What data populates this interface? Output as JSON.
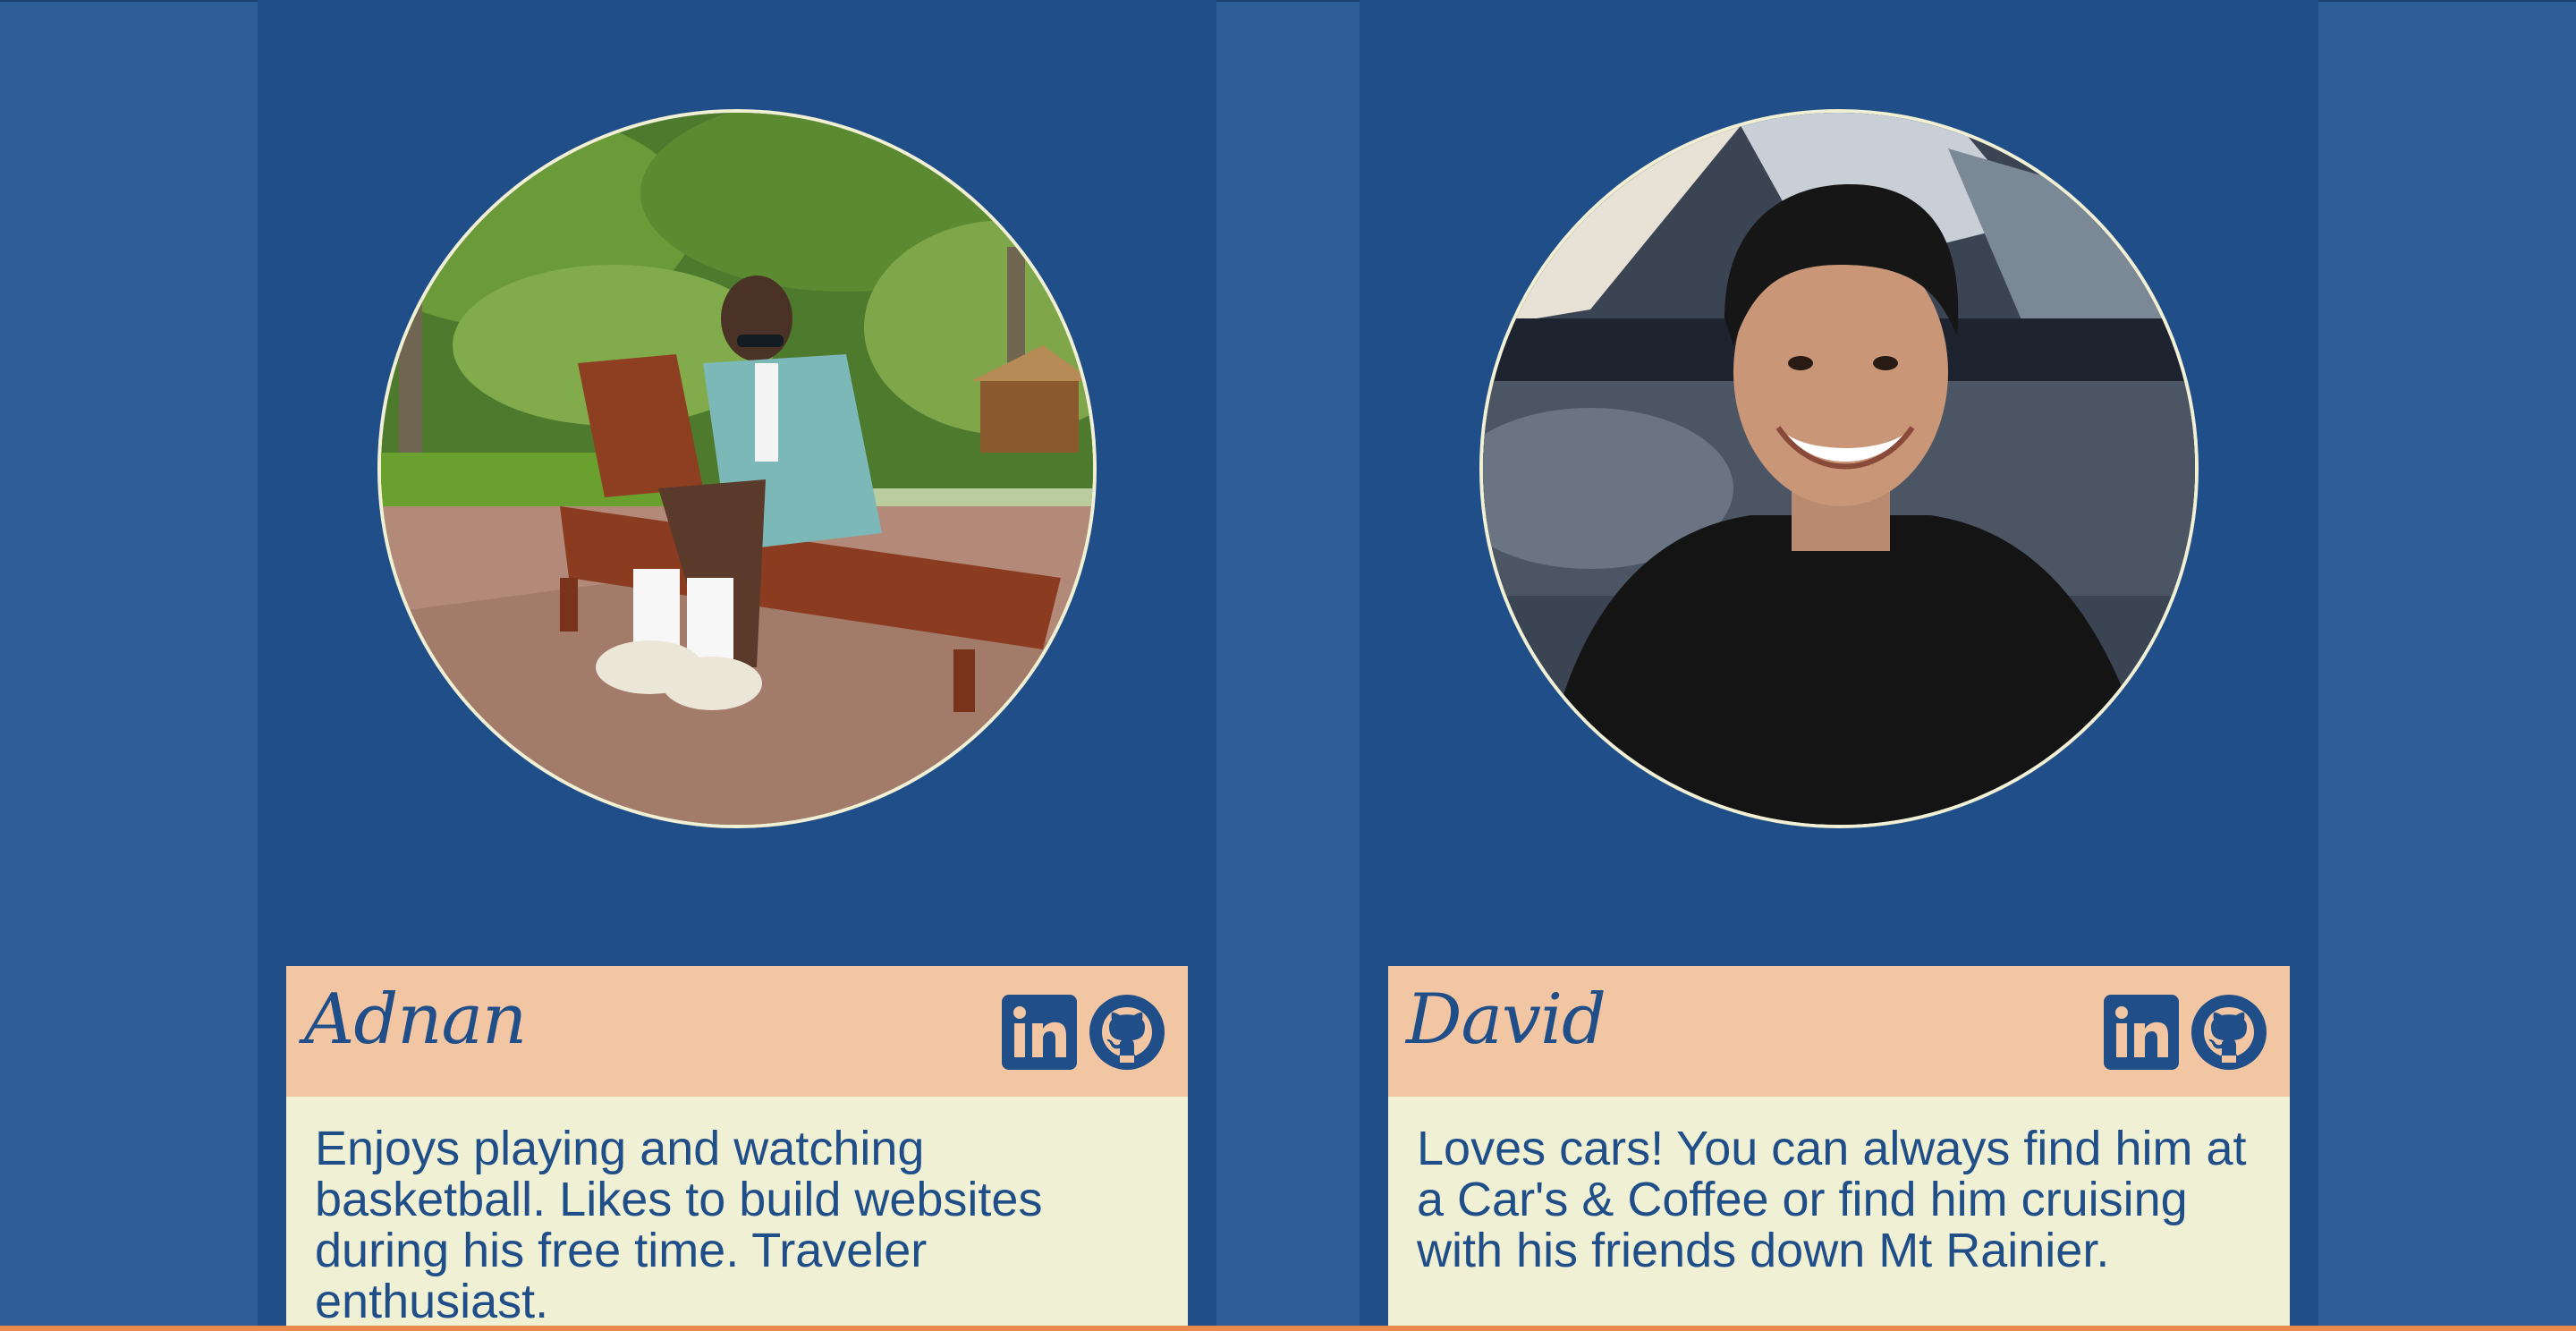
{
  "cards": [
    {
      "name": "Adnan",
      "bio": "Enjoys playing and watching basketball. Likes to build websites during his free time. Traveler enthusiast.",
      "linkedin_icon": "linkedin-icon",
      "github_icon": "github-icon",
      "photo": "portrait photo: man in sunglasses and patterned shirt sitting on a wooden lounge chair among palm trees"
    },
    {
      "name": "David",
      "bio": "Loves cars! You can always find him at a Car's & Coffee or find him cruising with his friends down Mt Rainier.",
      "linkedin_icon": "linkedin-icon",
      "github_icon": "github-icon",
      "photo": "portrait photo: smiling man in black t-shirt in front of a dark car"
    }
  ],
  "colors": {
    "background": "#2e5e95",
    "column": "#1f4e88",
    "header": "#f2c5a3",
    "body": "#f0f0d4",
    "text": "#1f4e88",
    "accent_bottom": "#e98a4c"
  }
}
